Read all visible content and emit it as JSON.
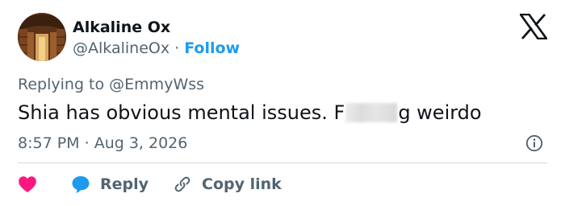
{
  "author": {
    "name": "Alkaline Ox",
    "handle": "@AlkalineOx",
    "separator": "·",
    "follow_label": "Follow",
    "avatar_icon": "library-photo-avatar"
  },
  "brand": {
    "icon": "x-logo-icon"
  },
  "tweet": {
    "replying_prefix": "Replying to",
    "replying_to": "@EmmyWss",
    "text_before": "Shia has obvious mental issues. F",
    "text_after": "g weirdo",
    "time": "8:57 PM",
    "date_separator": "·",
    "date": "Aug 3, 2026"
  },
  "actions": {
    "like_icon": "heart-icon",
    "reply_icon": "speech-bubble-icon",
    "reply_label": "Reply",
    "copy_icon": "link-icon",
    "copy_label": "Copy link",
    "info_icon": "info-icon"
  },
  "colors": {
    "text": "#0f1419",
    "muted": "#536471",
    "accent": "#1d9bf0",
    "like": "#f91880",
    "divider": "#cfd9de"
  }
}
